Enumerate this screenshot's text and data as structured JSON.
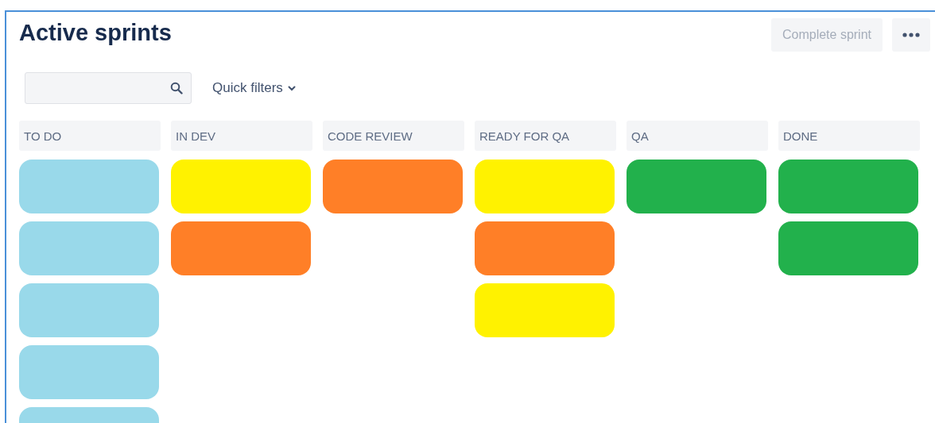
{
  "title": "Active sprints",
  "actions": {
    "complete_sprint": {
      "label": "Complete sprint",
      "disabled": true
    }
  },
  "quick_filters": {
    "label": "Quick filters"
  },
  "columns": [
    {
      "title": "TO DO",
      "cards": [
        {
          "color": "#99d9ea"
        },
        {
          "color": "#99d9ea"
        },
        {
          "color": "#99d9ea"
        },
        {
          "color": "#99d9ea"
        },
        {
          "color": "#99d9ea"
        }
      ]
    },
    {
      "title": "IN DEV",
      "cards": [
        {
          "color": "#fff200"
        },
        {
          "color": "#ff7f27"
        }
      ]
    },
    {
      "title": "CODE REVIEW",
      "cards": [
        {
          "color": "#ff7f27"
        }
      ]
    },
    {
      "title": "READY FOR QA",
      "cards": [
        {
          "color": "#fff200"
        },
        {
          "color": "#ff7f27"
        },
        {
          "color": "#fff200"
        }
      ]
    },
    {
      "title": "QA",
      "cards": [
        {
          "color": "#22b14c"
        }
      ]
    },
    {
      "title": "DONE",
      "cards": [
        {
          "color": "#22b14c"
        },
        {
          "color": "#22b14c"
        }
      ]
    }
  ]
}
